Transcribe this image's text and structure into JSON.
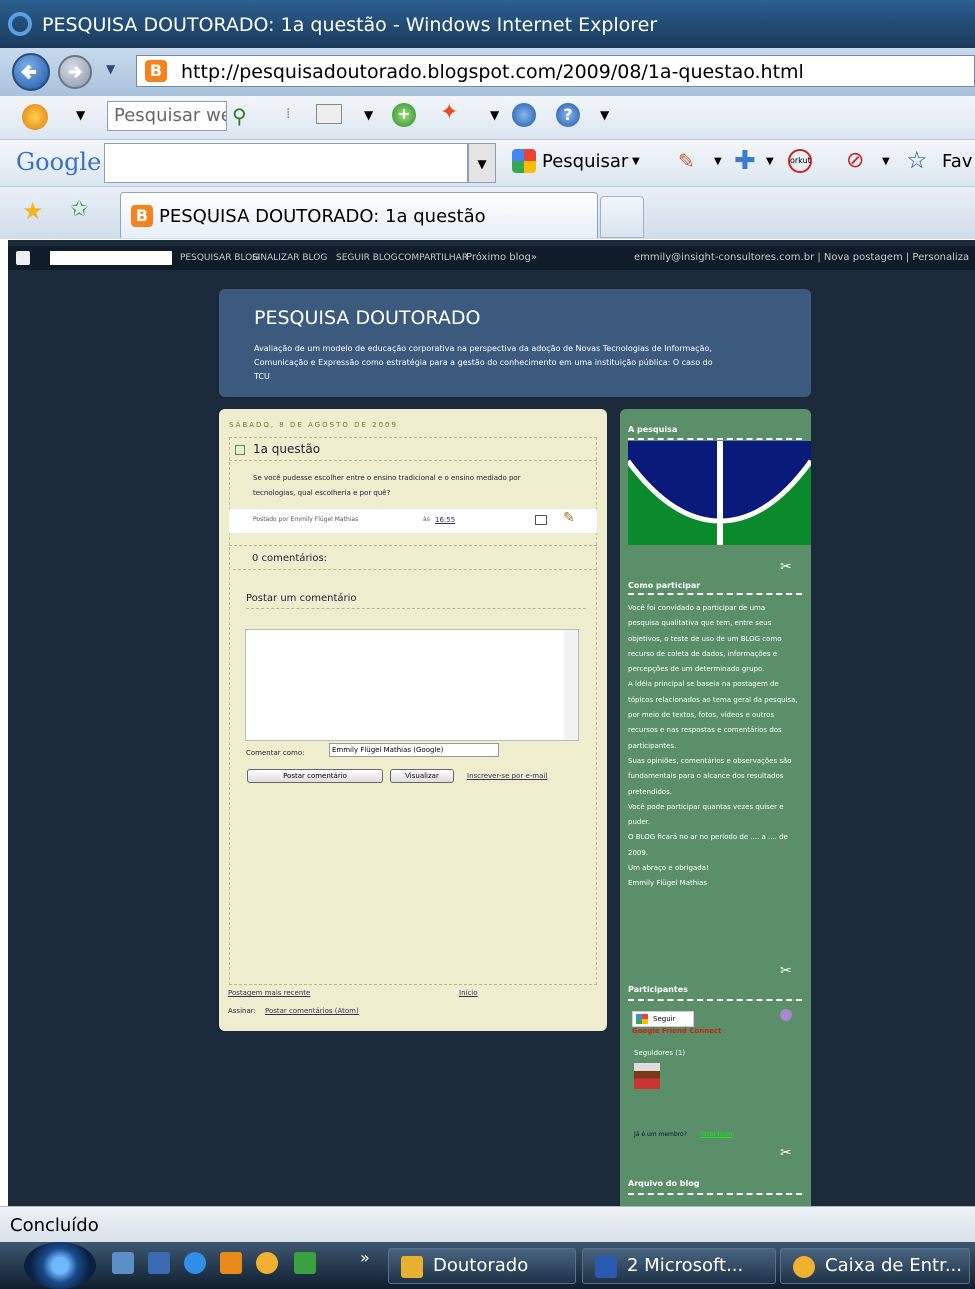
{
  "window": {
    "title": "PESQUISA DOUTORADO: 1a questão - Windows Internet Explorer"
  },
  "nav": {
    "url": "http://pesquisadoutorado.blogspot.com/2009/08/1a-questao.html"
  },
  "toolbar1": {
    "search_placeholder": "Pesquisar we"
  },
  "google_toolbar": {
    "logo": "Google",
    "search_label": "Pesquisar",
    "favorites_label": "Fav"
  },
  "tabs": [
    {
      "label": "PESQUISA DOUTORADO: 1a questão"
    }
  ],
  "blogger_nav": {
    "links": [
      "PESQUISAR BLOG",
      "SINALIZAR BLOG",
      "SEGUIR BLOG",
      "COMPARTILHAR",
      "Próximo blog»"
    ],
    "right": "emmily@insight-consultores.com.br | Nova postagem | Personaliza"
  },
  "blog": {
    "title": "PESQUISA DOUTORADO",
    "description": "Avaliação de um modelo de educação corporativa na perspectiva da adoção de Novas Tecnologias de Informação, Comunicação e Expressão como estratégia para a gestão do conhecimento em uma instituição pública: O caso do TCU"
  },
  "post": {
    "date": "SÁBADO, 8 DE AGOSTO DE 2009",
    "title": "1a questão",
    "body": "Se você pudesse escolher entre o ensino tradicional e o ensino mediado por tecnologias, qual escolheria e por quê?",
    "posted_by": "Postado por Emmily Flügel Mathias",
    "at": "às",
    "time": "16:55",
    "comments_count": "0 comentários:",
    "post_comment_heading": "Postar um comentário",
    "comment_as_label": "Comentar como:",
    "comment_as_value": "Emmily Flügel Mathias (Google)",
    "publish_button": "Postar comentário",
    "preview_button": "Visualizar",
    "subscribe_email": "Inscrever-se por e-mail",
    "newer_post": "Postagem mais recente",
    "home": "Início",
    "subscribe_label": "Assinar:",
    "subscribe_link": "Postar comentários (Atom)"
  },
  "sidebar": {
    "research_heading": "A pesquisa",
    "how_heading": "Como participar",
    "how_text": "Você foi convidado a participar de uma pesquisa qualitativa que tem, entre seus objetivos, o teste de uso de um BLOG como recurso de coleta de dados, informações e percepções de um determinado grupo.\nA idéia principal se baseia na postagem de tópicos relacionados ao tema geral da pesquisa, por meio de textos, fotos, vídeos e outros recursos e nas respostas e comentários dos participantes.\nSuas opiniões, comentários e observações são fundamentais para o alcance dos resultados pretendidos.\nVocê pode participar quantas vezes quiser e puder.\nO BLOG ficará no ar no período de .... a .... de 2009.\nUm abraço e obrigada!\nEmmily Flügel Mathias",
    "participants_heading": "Participantes",
    "follow_button": "Seguir",
    "gfc": "Google Friend Connect",
    "followers": "Seguidores (1)",
    "member_prompt": "Já é um membro?",
    "login": "Fazer login",
    "archive_heading": "Arquivo do blog"
  },
  "status": {
    "text": "Concluído"
  },
  "taskbar": {
    "items": [
      {
        "label": "Doutorado"
      },
      {
        "label": "2 Microsoft..."
      },
      {
        "label": "Caixa de Entr..."
      }
    ],
    "chevron": "»"
  },
  "colors": {
    "accent": "#3b5a7e",
    "sidebar": "#5a8f6a",
    "post_bg": "#eeeecf"
  }
}
